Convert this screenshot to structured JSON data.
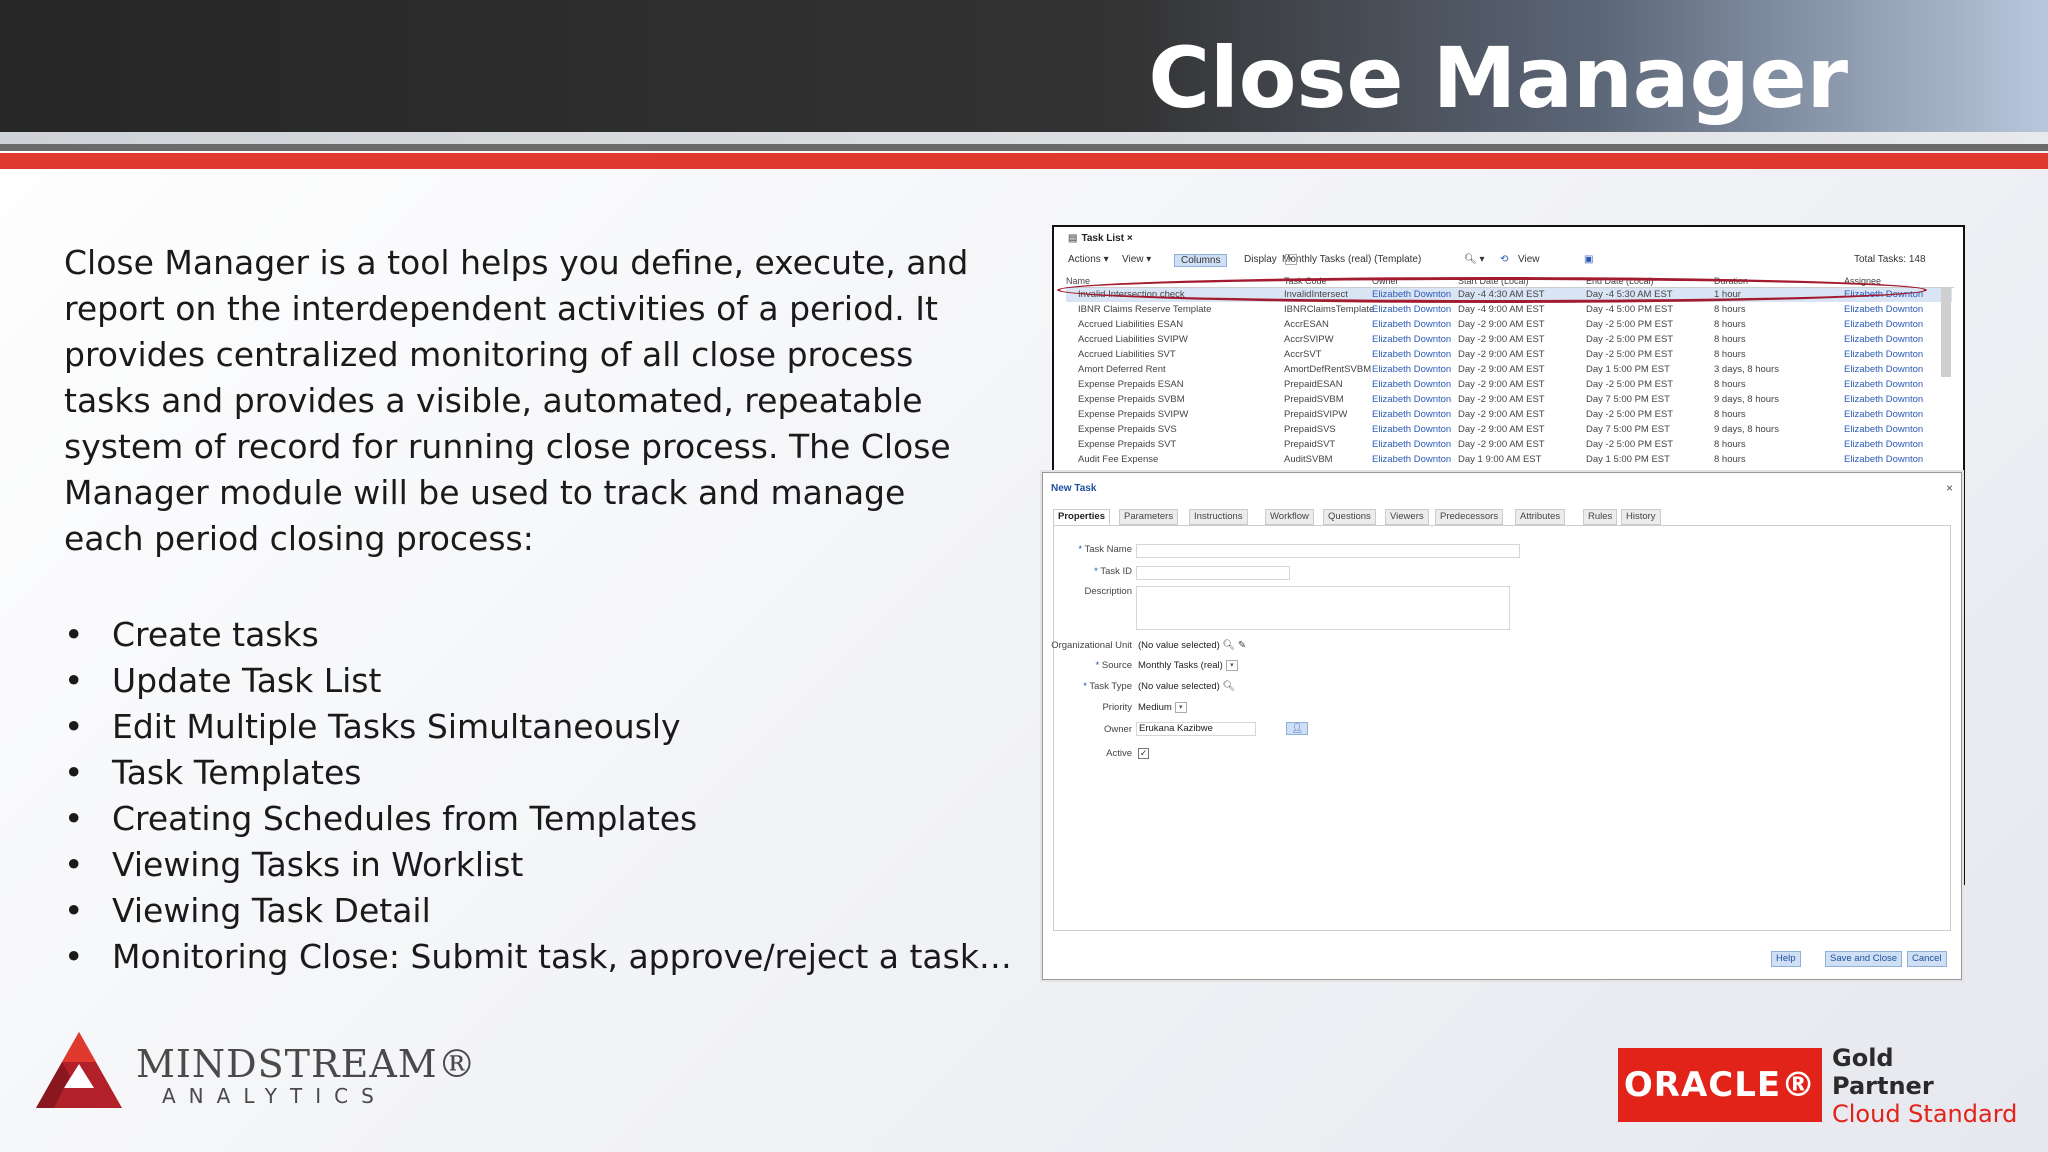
{
  "header": {
    "title": "Close Manager"
  },
  "intro": "Close Manager is a tool helps you define, execute, and report on the interdependent activities of a period. It provides centralized monitoring of all close process tasks and provides a visible, automated, repeatable system of record for running close process. The Close Manager module will be used to track and manage each period closing process:",
  "bullets": [
    "Create tasks",
    "Update Task List",
    "Edit Multiple Tasks Simultaneously",
    "Task Templates",
    "Creating Schedules from Templates",
    "Viewing Tasks in Worklist",
    "Viewing Task Detail",
    "Monitoring Close: Submit task, approve/reject a task…"
  ],
  "task_list": {
    "tab_label": "Task List",
    "actions_label": "Actions ▾",
    "view_label": "View ▾",
    "columns_label": "Columns",
    "display_label": "Display",
    "display_value": "Monthly Tasks (real) (Template)",
    "view2_label": "View",
    "total_label": "Total Tasks: 148",
    "columns": [
      "Name",
      "Task Code",
      "Owner",
      "Start Date (Local)",
      "End Date (Local)",
      "Duration",
      "Assignee"
    ],
    "rows": [
      [
        "Invalid Intersection check",
        "InvalidIntersect",
        "Elizabeth Downton",
        "Day -4 4:30 AM EST",
        "Day -4 5:30 AM EST",
        "1 hour",
        "Elizabeth Downton"
      ],
      [
        "IBNR Claims Reserve Template",
        "IBNRClaimsTemplate",
        "Elizabeth Downton",
        "Day -4 9:00 AM EST",
        "Day -4 5:00 PM EST",
        "8 hours",
        "Elizabeth Downton"
      ],
      [
        "Accrued Liabilities ESAN",
        "AccrESAN",
        "Elizabeth Downton",
        "Day -2 9:00 AM EST",
        "Day -2 5:00 PM EST",
        "8 hours",
        "Elizabeth Downton"
      ],
      [
        "Accrued Liabilities SVIPW",
        "AccrSVIPW",
        "Elizabeth Downton",
        "Day -2 9:00 AM EST",
        "Day -2 5:00 PM EST",
        "8 hours",
        "Elizabeth Downton"
      ],
      [
        "Accrued Liabilities SVT",
        "AccrSVT",
        "Elizabeth Downton",
        "Day -2 9:00 AM EST",
        "Day -2 5:00 PM EST",
        "8 hours",
        "Elizabeth Downton"
      ],
      [
        "Amort Deferred Rent",
        "AmortDefRentSVBM",
        "Elizabeth Downton",
        "Day -2 9:00 AM EST",
        "Day 1 5:00 PM EST",
        "3 days, 8 hours",
        "Elizabeth Downton"
      ],
      [
        "Expense Prepaids ESAN",
        "PrepaidESAN",
        "Elizabeth Downton",
        "Day -2 9:00 AM EST",
        "Day -2 5:00 PM EST",
        "8 hours",
        "Elizabeth Downton"
      ],
      [
        "Expense Prepaids SVBM",
        "PrepaidSVBM",
        "Elizabeth Downton",
        "Day -2 9:00 AM EST",
        "Day 7 5:00 PM EST",
        "9 days, 8 hours",
        "Elizabeth Downton"
      ],
      [
        "Expense Prepaids SVIPW",
        "PrepaidSVIPW",
        "Elizabeth Downton",
        "Day -2 9:00 AM EST",
        "Day -2 5:00 PM EST",
        "8 hours",
        "Elizabeth Downton"
      ],
      [
        "Expense Prepaids SVS",
        "PrepaidSVS",
        "Elizabeth Downton",
        "Day -2 9:00 AM EST",
        "Day 7 5:00 PM EST",
        "9 days, 8 hours",
        "Elizabeth Downton"
      ],
      [
        "Expense Prepaids SVT",
        "PrepaidSVT",
        "Elizabeth Downton",
        "Day -2 9:00 AM EST",
        "Day -2 5:00 PM EST",
        "8 hours",
        "Elizabeth Downton"
      ],
      [
        "Audit Fee Expense",
        "AuditSVBM",
        "Elizabeth Downton",
        "Day 1 9:00 AM EST",
        "Day 1 5:00 PM EST",
        "8 hours",
        "Elizabeth Downton"
      ]
    ]
  },
  "new_task": {
    "title": "New Task",
    "close_glyph": "×",
    "tabs": [
      "Properties",
      "Parameters",
      "Instructions",
      "Workflow",
      "Questions",
      "Viewers",
      "Predecessors",
      "Attributes",
      "Rules",
      "History"
    ],
    "fields": {
      "task_name": "Task Name",
      "task_id": "Task ID",
      "description": "Description",
      "org_unit": "Organizational Unit",
      "org_unit_value": "(No value selected)",
      "source": "Source",
      "source_value": "Monthly Tasks (real)",
      "task_type": "Task Type",
      "task_type_value": "(No value selected)",
      "priority": "Priority",
      "priority_value": "Medium",
      "owner": "Owner",
      "owner_value": "Erukana Kazibwe",
      "active": "Active"
    },
    "buttons": {
      "help": "Help",
      "save_close": "Save and Close",
      "cancel": "Cancel"
    }
  },
  "footer": {
    "brand_name": "MINDSTREAM®",
    "brand_sub": "ANALYTICS",
    "oracle": "ORACLE®",
    "gold": "Gold",
    "partner": "Partner",
    "cloud": "Cloud Standard"
  },
  "colors": {
    "accent_red": "#e03a2f",
    "oracle_red": "#e2231a",
    "header_dark": "#2b2b2b",
    "link_blue": "#2a5ab8"
  }
}
